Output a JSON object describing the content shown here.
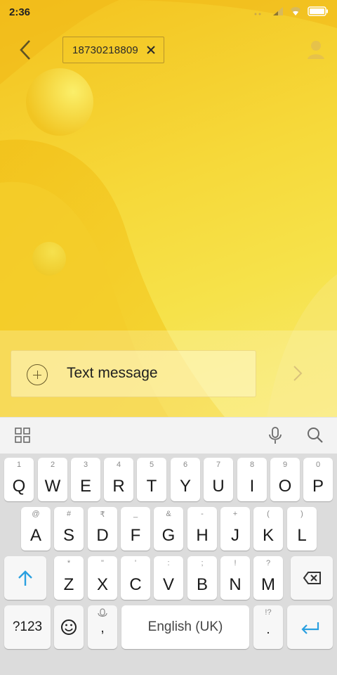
{
  "status_bar": {
    "time": "2:36"
  },
  "header": {
    "recipient": "18730218809"
  },
  "composer": {
    "placeholder": "Text message"
  },
  "keyboard": {
    "row1": [
      {
        "hint": "1",
        "label": "Q"
      },
      {
        "hint": "2",
        "label": "W"
      },
      {
        "hint": "3",
        "label": "E"
      },
      {
        "hint": "4",
        "label": "R"
      },
      {
        "hint": "5",
        "label": "T"
      },
      {
        "hint": "6",
        "label": "Y"
      },
      {
        "hint": "7",
        "label": "U"
      },
      {
        "hint": "8",
        "label": "I"
      },
      {
        "hint": "9",
        "label": "O"
      },
      {
        "hint": "0",
        "label": "P"
      }
    ],
    "row2": [
      {
        "hint": "@",
        "label": "A"
      },
      {
        "hint": "#",
        "label": "S"
      },
      {
        "hint": "₹",
        "label": "D"
      },
      {
        "hint": "_",
        "label": "F"
      },
      {
        "hint": "&",
        "label": "G"
      },
      {
        "hint": "-",
        "label": "H"
      },
      {
        "hint": "+",
        "label": "J"
      },
      {
        "hint": "(",
        "label": "K"
      },
      {
        "hint": ")",
        "label": "L"
      }
    ],
    "row3": [
      {
        "hint": "*",
        "label": "Z"
      },
      {
        "hint": "\"",
        "label": "X"
      },
      {
        "hint": "'",
        "label": "C"
      },
      {
        "hint": ":",
        "label": "V"
      },
      {
        "hint": ";",
        "label": "B"
      },
      {
        "hint": "!",
        "label": "N"
      },
      {
        "hint": "?",
        "label": "M"
      }
    ],
    "symbols_label": "?123",
    "comma_label": ",",
    "space_label": "English (UK)",
    "period_hint": "!?",
    "period_label": "."
  },
  "colors": {
    "accent": "#2aa0e0",
    "wallpaper": "#f6d93a"
  }
}
